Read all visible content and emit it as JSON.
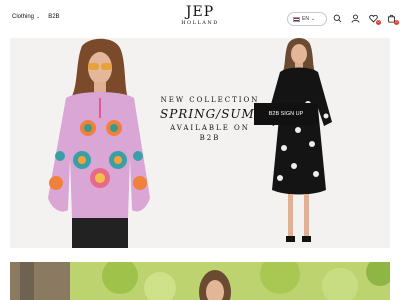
{
  "header": {
    "nav": [
      {
        "label": "Clothing",
        "has_dropdown": true
      },
      {
        "label": "B2B",
        "has_dropdown": false
      }
    ],
    "logo": {
      "main": "JEP",
      "sub": "HOLLAND"
    },
    "language": {
      "code": "EN",
      "flag": "us-flag-icon"
    },
    "icons": [
      "search-icon",
      "account-icon",
      "wishlist-icon",
      "cart-icon"
    ],
    "wishlist_count": "0",
    "cart_count": "0"
  },
  "hero": {
    "line1": "NEW COLLECTION",
    "line2": "SPRING/SUMMER",
    "line3": "AVAILABLE ON B2B",
    "cta_label": "B2B SIGN UP",
    "background": "#f3f2f0"
  }
}
